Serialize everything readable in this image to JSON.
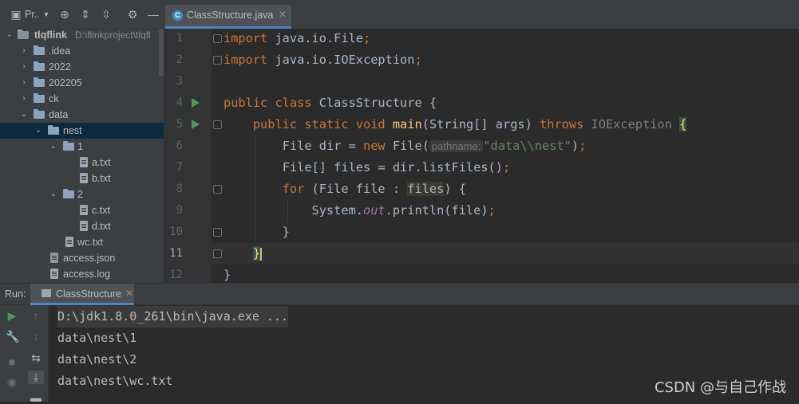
{
  "project_panel": {
    "toolbar_label": "Pr..",
    "tree": [
      {
        "name": "tlqflink",
        "path": "D:\\flinkproject\\tlqfl",
        "type": "module",
        "depth": 0,
        "expanded": true
      },
      {
        "name": ".idea",
        "type": "folder",
        "depth": 1,
        "expanded": false
      },
      {
        "name": "2022",
        "type": "folder",
        "depth": 1,
        "expanded": false
      },
      {
        "name": "202205",
        "type": "folder",
        "depth": 1,
        "expanded": false
      },
      {
        "name": "ck",
        "type": "folder",
        "depth": 1,
        "expanded": false
      },
      {
        "name": "data",
        "type": "folder",
        "depth": 1,
        "expanded": true
      },
      {
        "name": "nest",
        "type": "folder",
        "depth": 2,
        "expanded": true,
        "selected": true
      },
      {
        "name": "1",
        "type": "folder",
        "depth": 3,
        "expanded": true
      },
      {
        "name": "a.txt",
        "type": "file",
        "depth": 4
      },
      {
        "name": "b.txt",
        "type": "file",
        "depth": 4
      },
      {
        "name": "2",
        "type": "folder",
        "depth": 3,
        "expanded": true
      },
      {
        "name": "c.txt",
        "type": "file",
        "depth": 4
      },
      {
        "name": "d.txt",
        "type": "file",
        "depth": 4
      },
      {
        "name": "wc.txt",
        "type": "file",
        "depth": 3
      },
      {
        "name": "access.json",
        "type": "file",
        "depth": 2
      },
      {
        "name": "access.log",
        "type": "file",
        "depth": 2
      }
    ]
  },
  "editor": {
    "tab_label": "ClassStructure.java",
    "line_numbers": [
      "1",
      "2",
      "3",
      "4",
      "5",
      "6",
      "7",
      "8",
      "9",
      "10",
      "11",
      "12"
    ],
    "code": {
      "l1_kw": "import",
      "l1_rest": " java.io.File",
      "l1_semi": ";",
      "l2_kw": "import",
      "l2_rest": " java.io.IOException",
      "l2_semi": ";",
      "l4_kw": "public class",
      "l4_rest": " ClassStructure {",
      "l5_kw1": "public static void",
      "l5_fn": "main",
      "l5_mid": "(String[] args) ",
      "l5_kw2": "throws",
      "l5_exc": "IOException",
      "l5_brace": "{",
      "l6_a": "File dir = ",
      "l6_new": "new",
      "l6_b": " File(",
      "l6_hint": "pathname:",
      "l6_str": "\"data\\\\nest\"",
      "l6_c": ")",
      "l6_semi": ";",
      "l7_a": "File[] files = dir.listFiles()",
      "l7_semi": ";",
      "l8_kw": "for",
      "l8_a": " (File file : ",
      "l8_hl": "files",
      "l8_b": ") {",
      "l9_a": "System.",
      "l9_it": "out",
      "l9_b": ".println(file)",
      "l9_semi": ";",
      "l10": "}",
      "l11": "}",
      "l12": "}"
    }
  },
  "run_panel": {
    "label": "Run:",
    "tab_label": "ClassStructure",
    "command": "D:\\jdk1.8.0_261\\bin\\java.exe ...",
    "output": [
      "data\\nest\\1",
      "data\\nest\\2",
      "data\\nest\\wc.txt"
    ]
  },
  "watermark": "CSDN @与自己作战"
}
